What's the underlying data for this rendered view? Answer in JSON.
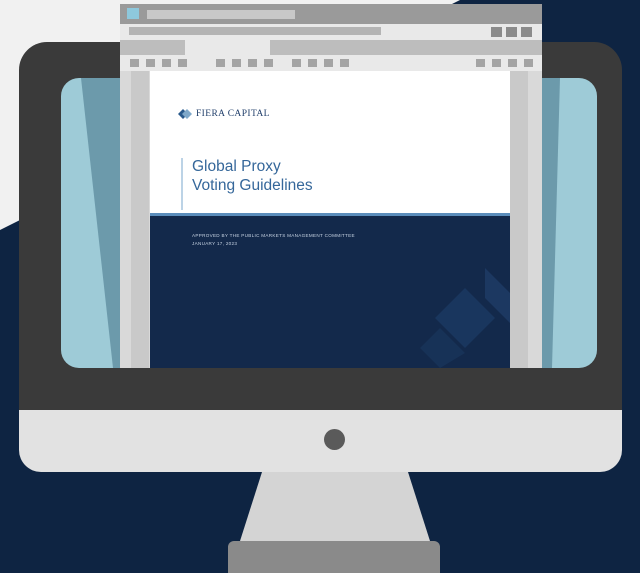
{
  "document": {
    "logo_text": "FIERA CAPITAL",
    "title_line1": "Global Proxy",
    "title_line2": "Voting Guidelines",
    "approved_line": "APPROVED BY THE PUBLIC MARKETS MANAGEMENT COMMITTEE",
    "date_line": "JANUARY 17, 2023"
  },
  "colors": {
    "background_navy": "#0e2442",
    "page_band": "#13294b",
    "title_blue": "#35679a",
    "screen_accent": "#9ecbd7"
  }
}
